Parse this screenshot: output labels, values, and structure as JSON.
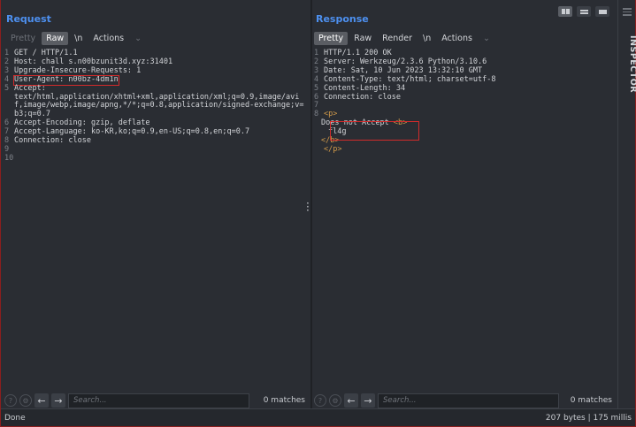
{
  "request": {
    "title": "Request",
    "tabs": [
      "Pretty",
      "Raw",
      "\\n",
      "Actions"
    ],
    "lines": [
      {
        "n": "1",
        "text": "GET / HTTP/1.1"
      },
      {
        "n": "2",
        "text": "Host: chall s.n00bzunit3d.xyz:31401"
      },
      {
        "n": "3",
        "text": "Upgrade-Insecure-Requests: 1"
      },
      {
        "n": "4",
        "text": "User-Agent: n00bz-4dm1n"
      },
      {
        "n": "5",
        "text": "Accept:"
      },
      {
        "n": "",
        "text": "text/html,application/xhtml+xml,application/xml;q=0.9,image/avif,image/webp,image/apng,*/*;q=0.8,application/signed-exchange;v=b3;q=0.7"
      },
      {
        "n": "6",
        "text": "Accept-Encoding: gzip, deflate"
      },
      {
        "n": "7",
        "text": "Accept-Language: ko-KR,ko;q=0.9,en-US;q=0.8,en;q=0.7"
      },
      {
        "n": "8",
        "text": "Connection: close"
      },
      {
        "n": "9",
        "text": ""
      },
      {
        "n": "10",
        "text": ""
      }
    ],
    "search_placeholder": "Search...",
    "matches": "0 matches"
  },
  "response": {
    "title": "Response",
    "tabs": [
      "Pretty",
      "Raw",
      "Render",
      "\\n",
      "Actions"
    ],
    "lines": [
      {
        "n": "1",
        "text": "HTTP/1.1 200 OK"
      },
      {
        "n": "2",
        "text": "Server: Werkzeug/2.3.6 Python/3.10.6"
      },
      {
        "n": "3",
        "text": "Date: Sat, 10 Jun 2023 13:32:10 GMT"
      },
      {
        "n": "4",
        "text": "Content-Type: text/html; charset=utf-8"
      },
      {
        "n": "5",
        "text": "Content-Length: 34"
      },
      {
        "n": "6",
        "text": "Connection: close"
      },
      {
        "n": "7",
        "text": ""
      }
    ],
    "body": {
      "n": "8",
      "p_open": "<p>",
      "text": "Does not Accept ",
      "b_open": "<b>",
      "flag": "fl4g",
      "b_close": "</b>",
      "p_close": "</p>"
    },
    "search_placeholder": "Search...",
    "matches": "0 matches"
  },
  "inspector": {
    "label": "INSPECTOR"
  },
  "status": {
    "left": "Done",
    "right": "207 bytes | 175 millis"
  }
}
